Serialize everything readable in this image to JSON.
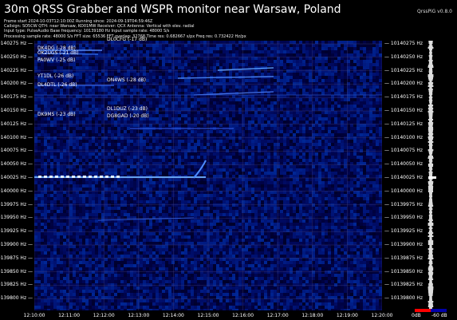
{
  "title": "30m QRSS Grabber and WSPR monitor near Warsaw, Poland",
  "version": "QrssPiG v0.8.0",
  "info_lines": [
    "Frame start 2024-10-03T12:10:00Z Running since: 2024-09-19T04:59:46Z",
    "Callsign: SO5CW QTH: near Warsaw, KO01MW Receiver: QCX Antenna: Vertical with elev. radial",
    "Input type: PulseAudio Base frequency: 10139180 Hz Input sample rate: 48000 S/s",
    "Processing sample rate: 48000 S/s FFT size: 65536 FFT overlap: 32768 Time res: 0.682667 s/px Freq res: 0.732422 Hz/px"
  ],
  "freq_labels": [
    "10140275 Hz",
    "10140250 Hz",
    "10140225 Hz",
    "10140200 Hz",
    "10140175 Hz",
    "10140150 Hz",
    "10140125 Hz",
    "10140100 Hz",
    "10140075 Hz",
    "10140050 Hz",
    "10140025 Hz",
    "10140000 Hz",
    "10139975 Hz",
    "10139950 Hz",
    "10139925 Hz",
    "10139900 Hz",
    "10139875 Hz",
    "10139850 Hz",
    "10139825 Hz",
    "10139800 Hz"
  ],
  "time_labels": [
    "12:10:00",
    "12:11:00",
    "12:12:00",
    "12:13:00",
    "12:14:00",
    "12:15:00",
    "12:16:00",
    "12:17:00",
    "12:18:00",
    "12:19:00",
    "12:20:00"
  ],
  "callsigns": [
    {
      "label": "DL0CFG (-17 dB)"
    },
    {
      "label": "DK4DG (-28 dB)"
    },
    {
      "label": "OK2UGS (-21 dB)"
    },
    {
      "label": "PA0WV (-25 dB)"
    },
    {
      "label": "YT1DL (-26 dB)"
    },
    {
      "label": "ON4WS (-28 dB)"
    },
    {
      "label": "DL4DTL (-26 dB)"
    },
    {
      "label": "DL1DUZ (-23 dB)"
    },
    {
      "label": "DK9MS (-23 dB)"
    },
    {
      "label": "DG8GAD (-20 dB)"
    }
  ],
  "spectrum_scale": [
    "0dB",
    "-60 dB"
  ]
}
